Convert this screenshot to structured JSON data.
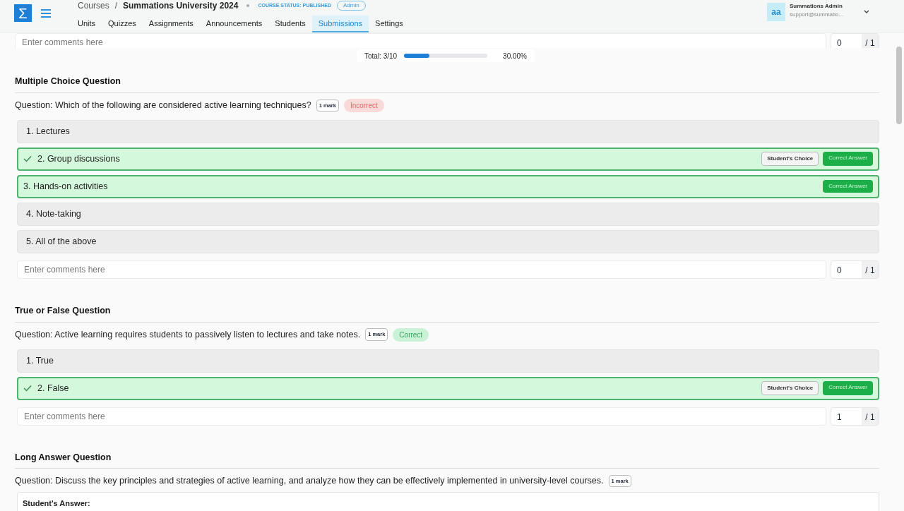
{
  "header": {
    "logo": "Σ",
    "breadcrumb": [
      "Courses",
      "Summations University 2024"
    ],
    "breadcrumb_separator": "/",
    "course_status": "COURSE STATUS: PUBLISHED",
    "role": "Admin",
    "tabs": [
      {
        "label": "Units",
        "selected": false
      },
      {
        "label": "Quizzes",
        "selected": false
      },
      {
        "label": "Assignments",
        "selected": false
      },
      {
        "label": "Announcements",
        "selected": false
      },
      {
        "label": "Students",
        "selected": false
      },
      {
        "label": "Submissions",
        "selected": true
      },
      {
        "label": "Settings",
        "selected": false
      }
    ],
    "user": {
      "initials": "aa",
      "name": "Summations Admin",
      "email": "support@summatio..."
    }
  },
  "total": {
    "label": "Total: 3/10",
    "level": 0.3,
    "percent": "30.00%"
  },
  "sections": [
    {
      "kind": "grading",
      "comment_placeholder": "Enter comments here",
      "score": "0",
      "max": "/ 1"
    },
    {
      "kind": "choice",
      "title": "Multiple Choice Question",
      "question": "Question: Which of the following are considered active learning techniques?",
      "marks": "1 mark",
      "result": {
        "text": "Incorrect",
        "correct": false
      },
      "options": [
        {
          "label": "1. Lectures",
          "student_choice": false,
          "correct": false
        },
        {
          "label": "2. Group discussions",
          "student_choice": true,
          "correct": true,
          "badges": [
            "Student's Choice",
            "Correct Answer"
          ]
        },
        {
          "label": "3. Hands-on activities",
          "student_choice": false,
          "correct": true,
          "badges": [
            "Correct Answer"
          ]
        },
        {
          "label": "4. Note-taking",
          "student_choice": false,
          "correct": false
        },
        {
          "label": "5. All of the above",
          "student_choice": false,
          "correct": false
        }
      ],
      "comment_placeholder": "Enter comments here",
      "score": "0",
      "max": "/ 1"
    },
    {
      "kind": "choice",
      "title": "True or False Question",
      "question": "Question: Active learning requires students to passively listen to lectures and take notes.",
      "marks": "1 mark",
      "result": {
        "text": "Correct",
        "correct": true
      },
      "options": [
        {
          "label": "1. True",
          "student_choice": false,
          "correct": false
        },
        {
          "label": "2. False",
          "student_choice": true,
          "correct": true,
          "badges": [
            "Student's Choice",
            "Correct Answer"
          ]
        }
      ],
      "comment_placeholder": "Enter comments here",
      "score": "1",
      "max": "/ 1"
    },
    {
      "kind": "long",
      "title": "Long Answer Question",
      "question": "Question: Discuss the key principles and strategies of active learning, and analyze how they can be effectively implemented in university-level courses.",
      "marks": "1 mark",
      "answer_label": "Student's Answer:"
    }
  ]
}
